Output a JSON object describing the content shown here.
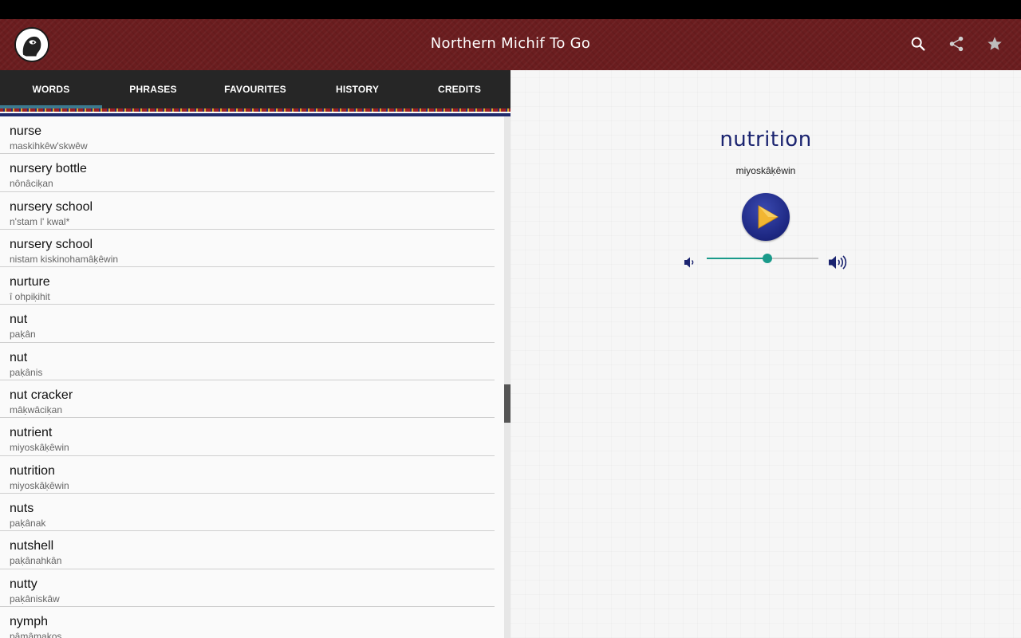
{
  "app": {
    "title": "Northern Michif To Go"
  },
  "actions": [
    {
      "name": "search-icon",
      "icon": "search-icon"
    },
    {
      "name": "share-icon",
      "icon": "share-icon"
    },
    {
      "name": "star-icon",
      "icon": "star-icon"
    }
  ],
  "tabs": [
    {
      "label": "WORDS",
      "active": true
    },
    {
      "label": "PHRASES",
      "active": false
    },
    {
      "label": "FAVOURITES",
      "active": false
    },
    {
      "label": "HISTORY",
      "active": false
    },
    {
      "label": "CREDITS",
      "active": false
    }
  ],
  "list": [
    {
      "word": "nurse",
      "translation": "maskihkêw'skwêw"
    },
    {
      "word": "nursery bottle",
      "translation": "nônâciḳan"
    },
    {
      "word": "nursery school",
      "translation": "n'stam l' kwal*"
    },
    {
      "word": "nursery school",
      "translation": "nistam kiskinohamâḳêwin"
    },
    {
      "word": "nurture",
      "translation": "î ohpiḳihit"
    },
    {
      "word": "nut",
      "translation": "paḳân"
    },
    {
      "word": "nut",
      "translation": "paḳânis"
    },
    {
      "word": "nut cracker",
      "translation": "mâḳwâciḳan"
    },
    {
      "word": "nutrient",
      "translation": "miyoskâḳêwin"
    },
    {
      "word": "nutrition",
      "translation": "miyoskâḳêwin"
    },
    {
      "word": "nuts",
      "translation": "paḳânak"
    },
    {
      "word": "nutshell",
      "translation": "paḳânahkân"
    },
    {
      "word": "nutty",
      "translation": "paḳâniskâw"
    },
    {
      "word": "nymph",
      "translation": "pâmâmakos"
    }
  ],
  "detail": {
    "word": "nutrition",
    "translation": "miyoskâḳêwin",
    "volume_fraction": 0.54
  },
  "colors": {
    "appbar": "#6b1d1f",
    "tab_indicator": "#3b7a8f",
    "word_title": "#1b2470",
    "slider_accent": "#1a9a8a"
  }
}
